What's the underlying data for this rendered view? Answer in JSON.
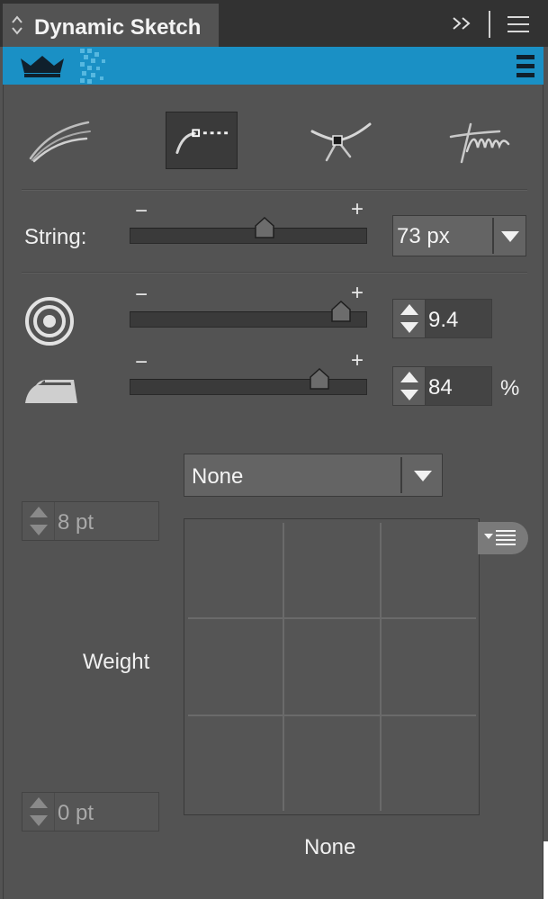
{
  "panel": {
    "title": "Dynamic Sketch",
    "expand_icon": "double-chevron-right-icon",
    "menu_icon": "hamburger-menu-icon"
  },
  "header": {
    "brand_icon": "crown-icon",
    "menu_icon": "vertical-menu-icon",
    "accent_color": "#1a90c5"
  },
  "modes": [
    {
      "name": "sketch-strokes",
      "icon": "sketch-strokes-icon",
      "active": false
    },
    {
      "name": "string-path",
      "icon": "string-path-icon",
      "active": true
    },
    {
      "name": "anchor-point",
      "icon": "anchor-point-icon",
      "active": false
    },
    {
      "name": "scribble",
      "icon": "scribble-icon",
      "active": false
    }
  ],
  "string": {
    "label": "String:",
    "minus": "−",
    "plus": "+",
    "slider_fraction": 0.57,
    "value": "73 px"
  },
  "target": {
    "icon": "target-icon",
    "minus": "−",
    "plus": "+",
    "slider_fraction": 0.89,
    "value": "9.4"
  },
  "iron": {
    "icon": "iron-icon",
    "minus": "−",
    "plus": "+",
    "slider_fraction": 0.8,
    "value": "84",
    "unit": "%"
  },
  "weight": {
    "profile_select": "None",
    "max_value": "8 pt",
    "label": "Weight",
    "min_value": "0 pt",
    "grid_menu_icon": "grid-options-icon",
    "caption": "None"
  }
}
